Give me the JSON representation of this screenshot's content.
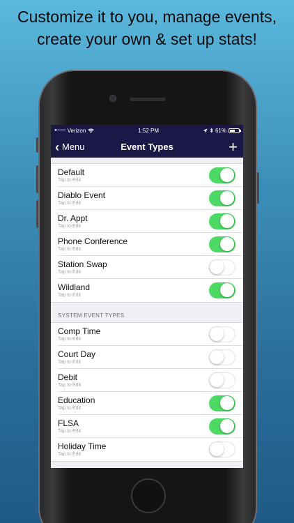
{
  "headline": {
    "line1": "Customize it to you, manage events,",
    "line2": "create your own & set up stats!"
  },
  "status_bar": {
    "signal": "●○○○○",
    "carrier": "Verizon",
    "wifi_icon": "wifi-icon",
    "time": "1:52 PM",
    "location_icon": "location-arrow-icon",
    "bluetooth_icon": "bluetooth-icon",
    "battery": "61%"
  },
  "nav": {
    "back_label": "Menu",
    "title": "Event Types",
    "add_label": "+"
  },
  "custom_events": [
    {
      "title": "Default",
      "subtitle": "Tap to Edit",
      "enabled": true
    },
    {
      "title": "Diablo Event",
      "subtitle": "Tap to Edit",
      "enabled": true
    },
    {
      "title": "Dr. Appt",
      "subtitle": "Tap to Edit",
      "enabled": true
    },
    {
      "title": "Phone Conference",
      "subtitle": "Tap to Edit",
      "enabled": true
    },
    {
      "title": "Station Swap",
      "subtitle": "Tap to Edit",
      "enabled": false
    },
    {
      "title": "Wildland",
      "subtitle": "Tap to Edit",
      "enabled": true
    }
  ],
  "system_section": {
    "header": "SYSTEM EVENT TYPES"
  },
  "system_events": [
    {
      "title": "Comp Time",
      "subtitle": "Tap to Edit",
      "enabled": false
    },
    {
      "title": "Court Day",
      "subtitle": "Tap to Edit",
      "enabled": false
    },
    {
      "title": "Debit",
      "subtitle": "Tap to Edit",
      "enabled": false
    },
    {
      "title": "Education",
      "subtitle": "Tap to Edit",
      "enabled": true
    },
    {
      "title": "FLSA",
      "subtitle": "Tap to Edit",
      "enabled": true
    },
    {
      "title": "Holiday Time",
      "subtitle": "Tap to Edit",
      "enabled": false
    }
  ],
  "colors": {
    "nav_bg": "#1a1846",
    "toggle_on": "#4cd964",
    "bg_gradient_top": "#5bb8dd",
    "bg_gradient_bottom": "#1f5a85"
  }
}
